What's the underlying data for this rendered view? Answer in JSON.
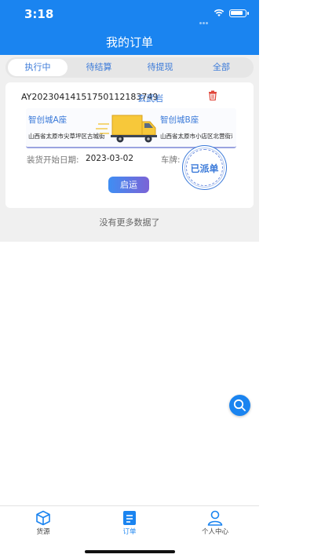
{
  "status_bar": {
    "time": "3:18"
  },
  "header": {
    "title": "我的订单"
  },
  "tabs": [
    {
      "label": "执行中",
      "active": true
    },
    {
      "label": "待结算",
      "active": false
    },
    {
      "label": "待提现",
      "active": false
    },
    {
      "label": "全部",
      "active": false
    }
  ],
  "order": {
    "id": "AY20230414151750112183749",
    "area": "玄武岩",
    "from": {
      "name": "智创城A座",
      "address": "山西省太原市尖草坪区古城街"
    },
    "to": {
      "name": "智创城B座",
      "address": "山西省太原市小店区北营街道"
    },
    "load_date_label": "装货开始日期:",
    "load_date": "2023-03-02",
    "plate_label": "车牌:",
    "status_stamp": "已派单",
    "action_button": "启运"
  },
  "list_footer": "没有更多数据了",
  "tabbar": [
    {
      "label": "货源",
      "icon": "cube-icon",
      "active": false
    },
    {
      "label": "订单",
      "icon": "document-icon",
      "active": true
    },
    {
      "label": "个人中心",
      "icon": "person-icon",
      "active": false
    }
  ],
  "colors": {
    "primary": "#1a84f0",
    "accent": "#3b7ad9",
    "stamp": "#3b7ad9"
  }
}
